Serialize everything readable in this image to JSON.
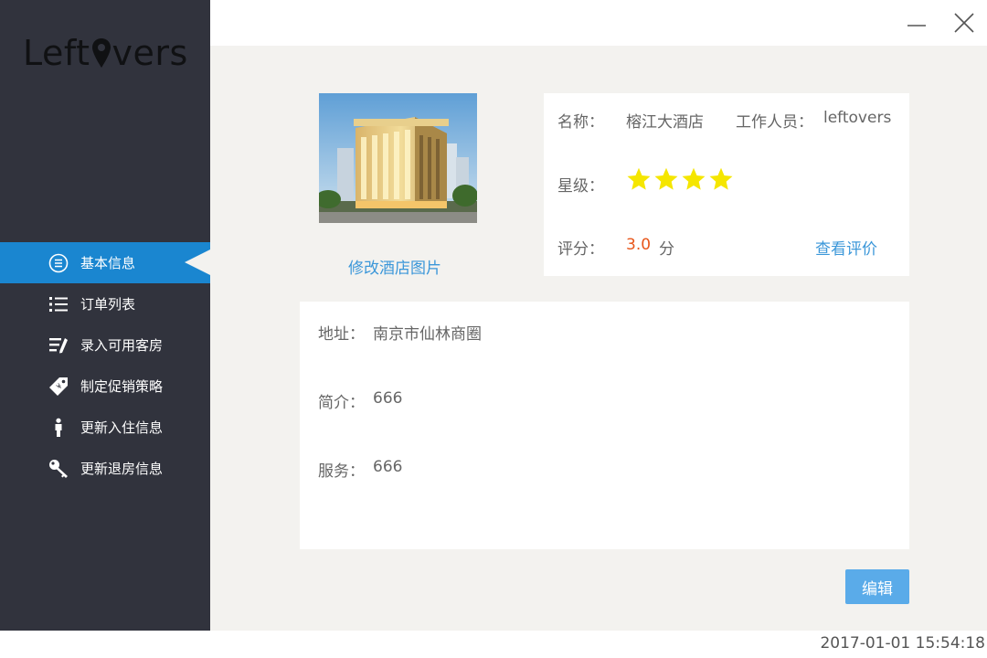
{
  "app": {
    "logo_text_left": "Left",
    "logo_text_right": "vers"
  },
  "sidebar": {
    "items": [
      {
        "label": "基本信息",
        "icon": "list-circle-icon",
        "active": true
      },
      {
        "label": "订单列表",
        "icon": "bullet-list-icon",
        "active": false
      },
      {
        "label": "录入可用客房",
        "icon": "edit-list-icon",
        "active": false
      },
      {
        "label": "制定促销策略",
        "icon": "price-tag-icon",
        "active": false
      },
      {
        "label": "更新入住信息",
        "icon": "person-icon",
        "active": false
      },
      {
        "label": "更新退房信息",
        "icon": "key-icon",
        "active": false
      }
    ]
  },
  "hotel": {
    "change_image_label": "修改酒店图片",
    "name_label": "名称：",
    "name": "榕江大酒店",
    "staff_label": "工作人员：",
    "staff": "leftovers",
    "star_label": "星级：",
    "star_count": 4,
    "score_label": "评分：",
    "score": "3.0",
    "score_unit": "分",
    "view_reviews_label": "查看评价",
    "address_label": "地址：",
    "address": "南京市仙林商圈",
    "intro_label": "简介：",
    "intro": "666",
    "service_label": "服务：",
    "service": "666"
  },
  "actions": {
    "edit_label": "编辑"
  },
  "status": {
    "datetime": "2017-01-01 15:54:18"
  },
  "colors": {
    "sidebar_bg": "#31333d",
    "active_item": "#1a86d0",
    "link": "#3b97d9",
    "score": "#e8561a",
    "star": "#f5e600",
    "button": "#5aabe9"
  }
}
